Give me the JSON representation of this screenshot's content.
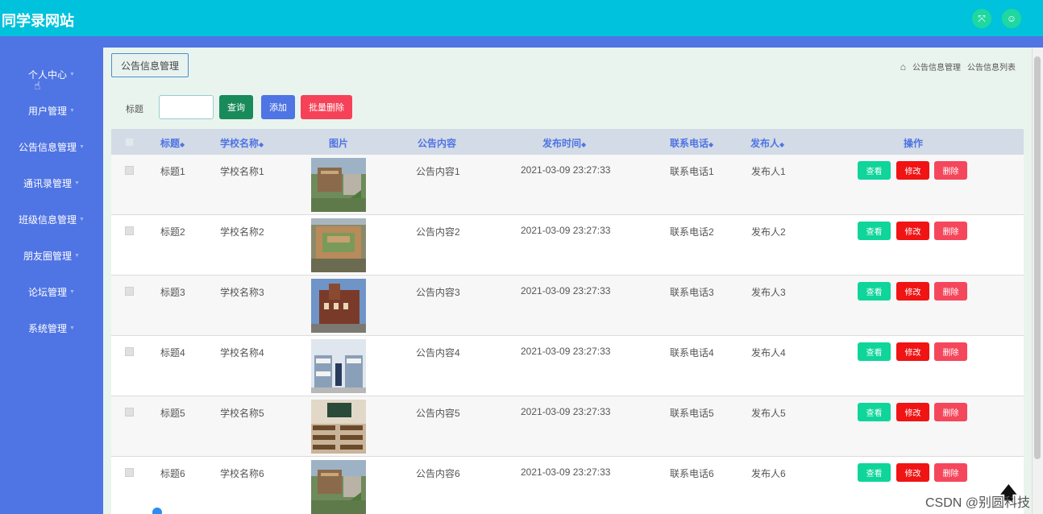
{
  "app": {
    "title": "同学录网站"
  },
  "colors": {
    "topbar": "#00c2dc",
    "sidebar": "#4f74e3",
    "content_bg": "#eaf4ef",
    "view": "#0fd59a",
    "edit": "#f01414",
    "delete": "#f5475c",
    "query": "#198a5a",
    "add": "#4f74e3"
  },
  "top_icons": [
    {
      "name": "fullscreen-icon",
      "glyph": "⤧"
    },
    {
      "name": "user-icon",
      "glyph": "☺"
    }
  ],
  "sidebar": {
    "items": [
      {
        "label": "个人中心"
      },
      {
        "label": "用户管理"
      },
      {
        "label": "公告信息管理"
      },
      {
        "label": "通讯录管理"
      },
      {
        "label": "班级信息管理"
      },
      {
        "label": "朋友圈管理"
      },
      {
        "label": "论坛管理"
      },
      {
        "label": "系统管理"
      }
    ]
  },
  "page": {
    "tab": "公告信息管理",
    "breadcrumb": [
      "公告信息管理",
      "公告信息列表"
    ]
  },
  "search": {
    "label": "标题",
    "value": "",
    "query_btn": "查询",
    "add_btn": "添加",
    "bulk_delete_btn": "批量删除"
  },
  "table": {
    "columns": [
      "标题",
      "学校名称",
      "图片",
      "公告内容",
      "发布时间",
      "联系电话",
      "发布人",
      "操作"
    ],
    "actions": {
      "view": "查看",
      "edit": "修改",
      "delete": "删除"
    },
    "rows": [
      {
        "title": "标题1",
        "school": "学校名称1",
        "content": "公告内容1",
        "time": "2021-03-09 23:27:33",
        "phone": "联系电话1",
        "publisher": "发布人1"
      },
      {
        "title": "标题2",
        "school": "学校名称2",
        "content": "公告内容2",
        "time": "2021-03-09 23:27:33",
        "phone": "联系电话2",
        "publisher": "发布人2"
      },
      {
        "title": "标题3",
        "school": "学校名称3",
        "content": "公告内容3",
        "time": "2021-03-09 23:27:33",
        "phone": "联系电话3",
        "publisher": "发布人3"
      },
      {
        "title": "标题4",
        "school": "学校名称4",
        "content": "公告内容4",
        "time": "2021-03-09 23:27:33",
        "phone": "联系电话4",
        "publisher": "发布人4"
      },
      {
        "title": "标题5",
        "school": "学校名称5",
        "content": "公告内容5",
        "time": "2021-03-09 23:27:33",
        "phone": "联系电话5",
        "publisher": "发布人5"
      },
      {
        "title": "标题6",
        "school": "学校名称6",
        "content": "公告内容6",
        "time": "2021-03-09 23:27:33",
        "phone": "联系电话6",
        "publisher": "发布人6"
      }
    ]
  },
  "watermark": "CSDN @别圆科技"
}
